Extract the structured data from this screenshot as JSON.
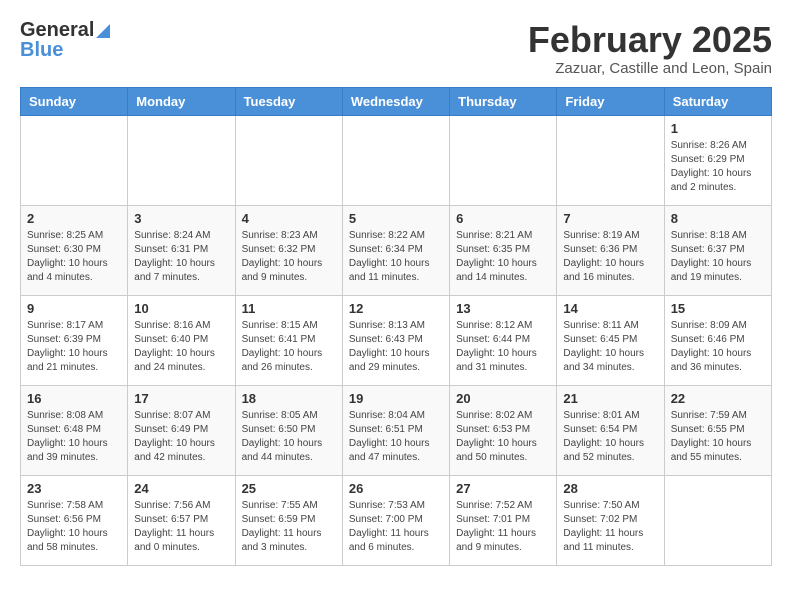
{
  "header": {
    "logo_general": "General",
    "logo_blue": "Blue",
    "title": "February 2025",
    "location": "Zazuar, Castille and Leon, Spain"
  },
  "days_of_week": [
    "Sunday",
    "Monday",
    "Tuesday",
    "Wednesday",
    "Thursday",
    "Friday",
    "Saturday"
  ],
  "weeks": [
    [
      {
        "day": "",
        "info": ""
      },
      {
        "day": "",
        "info": ""
      },
      {
        "day": "",
        "info": ""
      },
      {
        "day": "",
        "info": ""
      },
      {
        "day": "",
        "info": ""
      },
      {
        "day": "",
        "info": ""
      },
      {
        "day": "1",
        "info": "Sunrise: 8:26 AM\nSunset: 6:29 PM\nDaylight: 10 hours\nand 2 minutes."
      }
    ],
    [
      {
        "day": "2",
        "info": "Sunrise: 8:25 AM\nSunset: 6:30 PM\nDaylight: 10 hours\nand 4 minutes."
      },
      {
        "day": "3",
        "info": "Sunrise: 8:24 AM\nSunset: 6:31 PM\nDaylight: 10 hours\nand 7 minutes."
      },
      {
        "day": "4",
        "info": "Sunrise: 8:23 AM\nSunset: 6:32 PM\nDaylight: 10 hours\nand 9 minutes."
      },
      {
        "day": "5",
        "info": "Sunrise: 8:22 AM\nSunset: 6:34 PM\nDaylight: 10 hours\nand 11 minutes."
      },
      {
        "day": "6",
        "info": "Sunrise: 8:21 AM\nSunset: 6:35 PM\nDaylight: 10 hours\nand 14 minutes."
      },
      {
        "day": "7",
        "info": "Sunrise: 8:19 AM\nSunset: 6:36 PM\nDaylight: 10 hours\nand 16 minutes."
      },
      {
        "day": "8",
        "info": "Sunrise: 8:18 AM\nSunset: 6:37 PM\nDaylight: 10 hours\nand 19 minutes."
      }
    ],
    [
      {
        "day": "9",
        "info": "Sunrise: 8:17 AM\nSunset: 6:39 PM\nDaylight: 10 hours\nand 21 minutes."
      },
      {
        "day": "10",
        "info": "Sunrise: 8:16 AM\nSunset: 6:40 PM\nDaylight: 10 hours\nand 24 minutes."
      },
      {
        "day": "11",
        "info": "Sunrise: 8:15 AM\nSunset: 6:41 PM\nDaylight: 10 hours\nand 26 minutes."
      },
      {
        "day": "12",
        "info": "Sunrise: 8:13 AM\nSunset: 6:43 PM\nDaylight: 10 hours\nand 29 minutes."
      },
      {
        "day": "13",
        "info": "Sunrise: 8:12 AM\nSunset: 6:44 PM\nDaylight: 10 hours\nand 31 minutes."
      },
      {
        "day": "14",
        "info": "Sunrise: 8:11 AM\nSunset: 6:45 PM\nDaylight: 10 hours\nand 34 minutes."
      },
      {
        "day": "15",
        "info": "Sunrise: 8:09 AM\nSunset: 6:46 PM\nDaylight: 10 hours\nand 36 minutes."
      }
    ],
    [
      {
        "day": "16",
        "info": "Sunrise: 8:08 AM\nSunset: 6:48 PM\nDaylight: 10 hours\nand 39 minutes."
      },
      {
        "day": "17",
        "info": "Sunrise: 8:07 AM\nSunset: 6:49 PM\nDaylight: 10 hours\nand 42 minutes."
      },
      {
        "day": "18",
        "info": "Sunrise: 8:05 AM\nSunset: 6:50 PM\nDaylight: 10 hours\nand 44 minutes."
      },
      {
        "day": "19",
        "info": "Sunrise: 8:04 AM\nSunset: 6:51 PM\nDaylight: 10 hours\nand 47 minutes."
      },
      {
        "day": "20",
        "info": "Sunrise: 8:02 AM\nSunset: 6:53 PM\nDaylight: 10 hours\nand 50 minutes."
      },
      {
        "day": "21",
        "info": "Sunrise: 8:01 AM\nSunset: 6:54 PM\nDaylight: 10 hours\nand 52 minutes."
      },
      {
        "day": "22",
        "info": "Sunrise: 7:59 AM\nSunset: 6:55 PM\nDaylight: 10 hours\nand 55 minutes."
      }
    ],
    [
      {
        "day": "23",
        "info": "Sunrise: 7:58 AM\nSunset: 6:56 PM\nDaylight: 10 hours\nand 58 minutes."
      },
      {
        "day": "24",
        "info": "Sunrise: 7:56 AM\nSunset: 6:57 PM\nDaylight: 11 hours\nand 0 minutes."
      },
      {
        "day": "25",
        "info": "Sunrise: 7:55 AM\nSunset: 6:59 PM\nDaylight: 11 hours\nand 3 minutes."
      },
      {
        "day": "26",
        "info": "Sunrise: 7:53 AM\nSunset: 7:00 PM\nDaylight: 11 hours\nand 6 minutes."
      },
      {
        "day": "27",
        "info": "Sunrise: 7:52 AM\nSunset: 7:01 PM\nDaylight: 11 hours\nand 9 minutes."
      },
      {
        "day": "28",
        "info": "Sunrise: 7:50 AM\nSunset: 7:02 PM\nDaylight: 11 hours\nand 11 minutes."
      },
      {
        "day": "",
        "info": ""
      }
    ]
  ]
}
